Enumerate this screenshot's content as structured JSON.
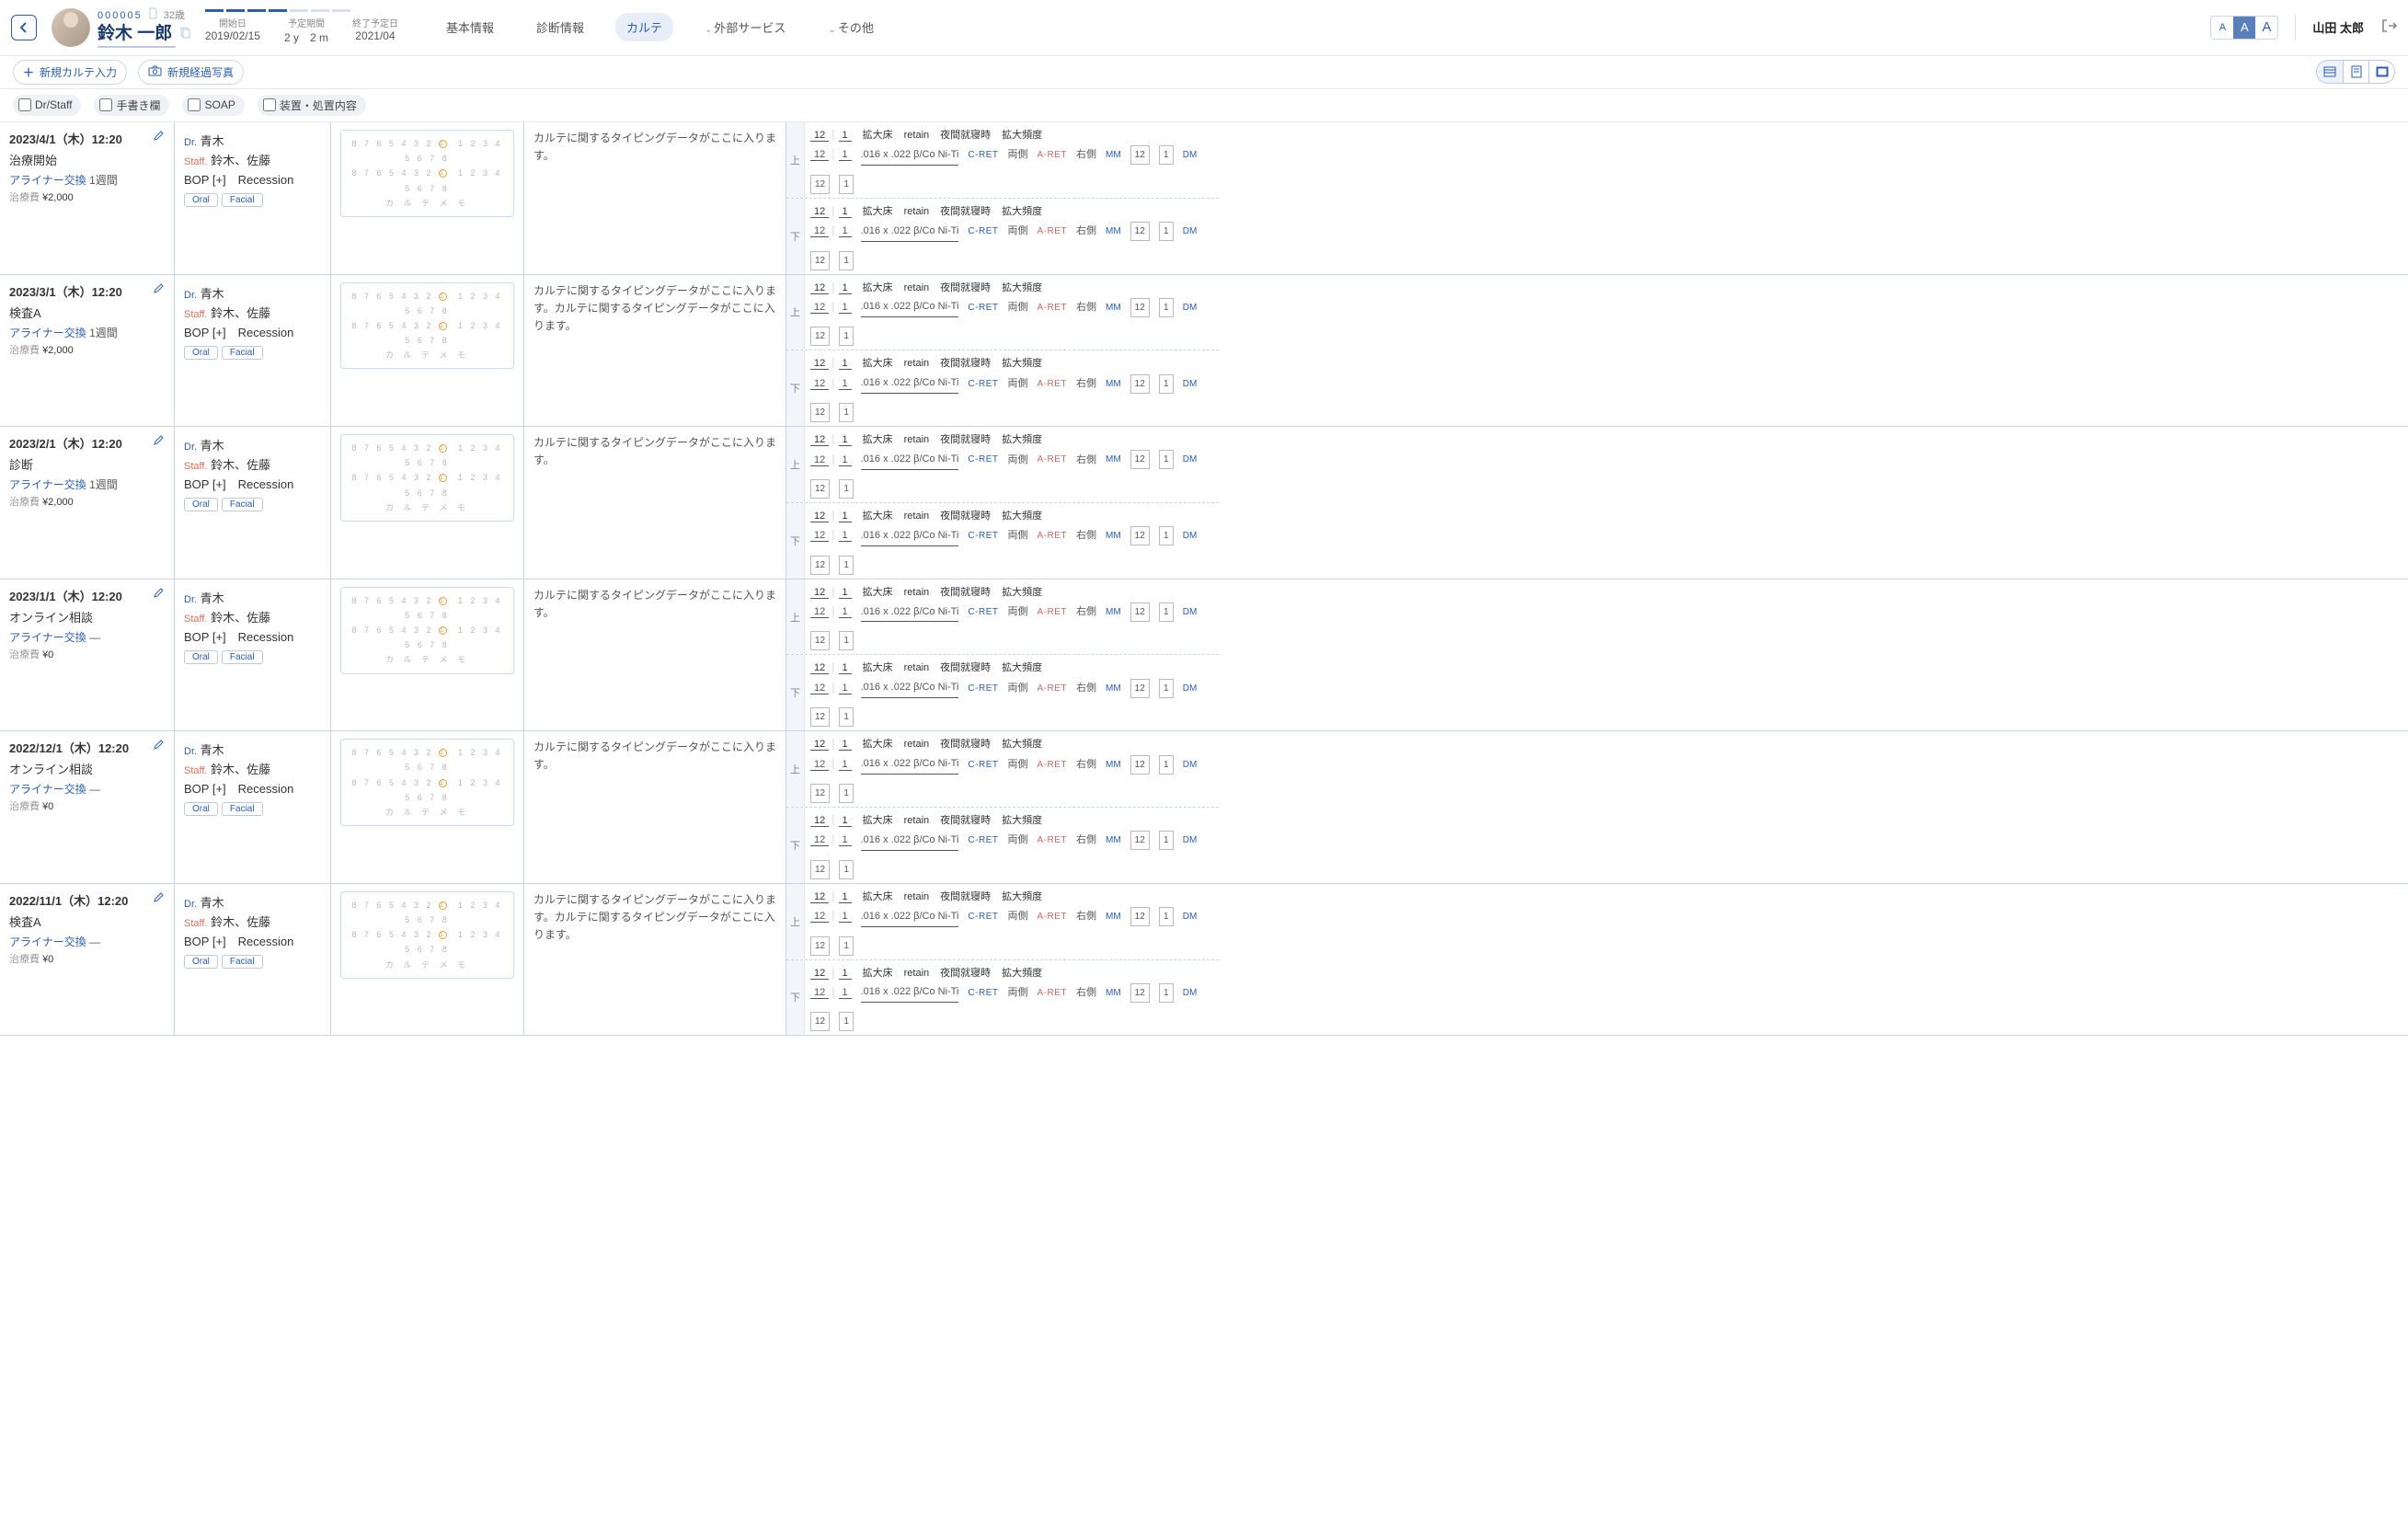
{
  "patient": {
    "id": "000005",
    "age": "32歳",
    "name": "鈴木 一郎",
    "start_label": "開始日",
    "start": "2019/02/15",
    "planned_label": "予定期間",
    "planned": "2 y　2 m",
    "end_label": "終了予定日",
    "end": "2021/04"
  },
  "top_tabs": {
    "basic": "基本情報",
    "diag": "診断情報",
    "karte": "カルテ",
    "external": "外部サービス",
    "other": "その他"
  },
  "user": "山田 太郎",
  "toolbar": {
    "new_karte": "新規カルテ入力",
    "new_photo": "新規経過写真"
  },
  "filters": {
    "dr_staff": "Dr/Staff",
    "handwrite": "手書き欄",
    "soap": "SOAP",
    "appliance": "装置・処置内容"
  },
  "memo": {
    "l": "8 7 6 5 4 3 2",
    "r": "1 2 3 4 5 6 7 8",
    "caption": "カ ル テ メ モ"
  },
  "appl": {
    "up": "上",
    "down": "下",
    "p1": "12",
    "p2": "1",
    "kakudai": "拡大床",
    "retain": "retain",
    "night": "夜間就寝時",
    "freq": "拡大頻度",
    "wire": ".016 x .022 β/Co Ni-Ti",
    "cret": "C-RET",
    "both": "両側",
    "aret": "A-RET",
    "right": "右側",
    "mm": "MM",
    "dm": "DM",
    "v1": "12",
    "v2": "1"
  },
  "rows": [
    {
      "date": "2023/4/1（木）12:20",
      "title": "治療開始",
      "aligner": "アライナー交換",
      "dur": "1週間",
      "fee_lbl": "治療費",
      "fee": "¥2,000",
      "dr": "青木",
      "staff": "鈴木、佐藤",
      "bop": "BOP [+]　Recession",
      "note": "カルテに関するタイピングデータがここに入ります。"
    },
    {
      "date": "2023/3/1（木）12:20",
      "title": "検査A",
      "aligner": "アライナー交換",
      "dur": "1週間",
      "fee_lbl": "治療費",
      "fee": "¥2,000",
      "dr": "青木",
      "staff": "鈴木、佐藤",
      "bop": "BOP [+]　Recession",
      "note": "カルテに関するタイピングデータがここに入ります。カルテに関するタイピングデータがここに入ります。"
    },
    {
      "date": "2023/2/1（木）12:20",
      "title": "診断",
      "aligner": "アライナー交換",
      "dur": "1週間",
      "fee_lbl": "治療費",
      "fee": "¥2,000",
      "dr": "青木",
      "staff": "鈴木、佐藤",
      "bop": "BOP [+]　Recession",
      "note": "カルテに関するタイピングデータがここに入ります。"
    },
    {
      "date": "2023/1/1（木）12:20",
      "small": true,
      "title": "オンライン相談",
      "aligner": "アライナー交換",
      "dur": "—",
      "fee_lbl": "治療費",
      "fee": "¥0",
      "dr": "青木",
      "staff": "鈴木、佐藤",
      "bop": "BOP [+]　Recession",
      "note": "カルテに関するタイピングデータがここに入ります。"
    },
    {
      "date": "2022/12/1（木）12:20",
      "title": "オンライン相談",
      "aligner": "アライナー交換",
      "dur": "—",
      "fee_lbl": "治療費",
      "fee": "¥0",
      "dr": "青木",
      "staff": "鈴木、佐藤",
      "bop": "BOP [+]　Recession",
      "note": "カルテに関するタイピングデータがここに入ります。"
    },
    {
      "date": "2022/11/1（木）12:20",
      "title": "検査A",
      "aligner": "アライナー交換",
      "dur": "—",
      "fee_lbl": "治療費",
      "fee": "¥0",
      "dr": "青木",
      "staff": "鈴木、佐藤",
      "bop": "BOP [+]　Recession",
      "note": "カルテに関するタイピングデータがここに入ります。カルテに関するタイピングデータがここに入ります。"
    }
  ],
  "labels": {
    "dr": "Dr.",
    "staff": "Staff.",
    "oral": "Oral",
    "facial": "Facial"
  }
}
